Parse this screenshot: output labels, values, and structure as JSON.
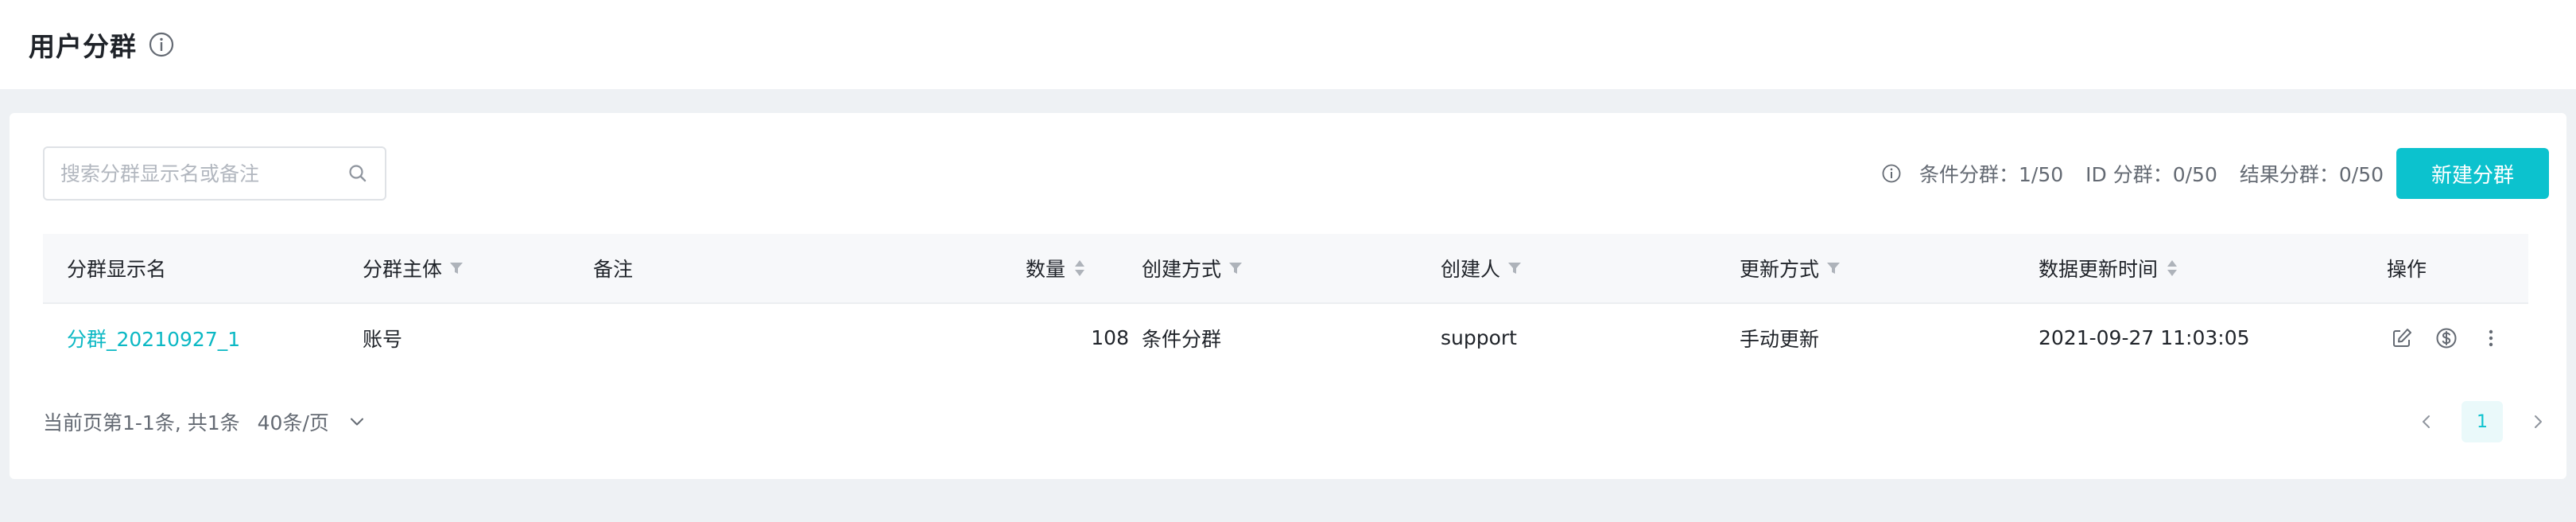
{
  "header": {
    "title": "用户分群",
    "info_icon": "info-circle-icon"
  },
  "toolbar": {
    "search_placeholder": "搜索分群显示名或备注",
    "search_value": "",
    "quota": [
      {
        "label": "条件分群：1/50"
      },
      {
        "label": "ID 分群：0/50"
      },
      {
        "label": "结果分群：0/50"
      }
    ],
    "new_button": "新建分群"
  },
  "table": {
    "columns": [
      {
        "label": "分群显示名"
      },
      {
        "label": "分群主体",
        "icon": "filter-icon"
      },
      {
        "label": "备注"
      },
      {
        "label": "数量",
        "icon": "sort-icon"
      },
      {
        "label": "创建方式",
        "icon": "filter-icon"
      },
      {
        "label": "创建人",
        "icon": "filter-icon"
      },
      {
        "label": "更新方式",
        "icon": "filter-icon"
      },
      {
        "label": "数据更新时间",
        "icon": "sort-icon"
      },
      {
        "label": "操作"
      }
    ],
    "rows": [
      {
        "name": "分群_20210927_1",
        "subject": "账号",
        "note": "",
        "count": "108",
        "create_method": "条件分群",
        "creator": "support",
        "update_method": "手动更新",
        "updated_at": "2021-09-27 11:03:05",
        "actions": [
          "edit-icon",
          "dollar-circle-icon",
          "more-vertical-icon"
        ]
      }
    ]
  },
  "footer": {
    "summary": "当前页第1-1条, 共1条",
    "page_size": "40条/页",
    "current_page": "1"
  },
  "colors": {
    "accent": "#0cc2ce",
    "link": "#0bb8c4",
    "background": "#eef1f4"
  }
}
